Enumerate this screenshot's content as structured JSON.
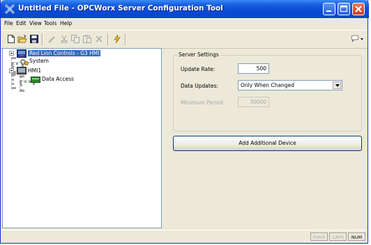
{
  "window": {
    "title": "Untitled File - OPCWorx Server Configuration Tool"
  },
  "menu": {
    "items": [
      "File",
      "Edit",
      "View",
      "Tools",
      "Help"
    ]
  },
  "toolbar": {
    "buttons": [
      "new-icon",
      "open-icon",
      "save-icon",
      "edit-icon",
      "cut-icon",
      "copy-icon",
      "paste-icon",
      "delete-icon",
      "lightning-icon",
      "help-icon"
    ]
  },
  "tree": {
    "root": "Red Lion Controls - G3 HMI",
    "system": "System",
    "hmi": "HMI1",
    "data_access": "Data Access"
  },
  "server_settings": {
    "title": "Server Settings",
    "update_rate_label": "Update Rate:",
    "update_rate_value": "500",
    "data_updates_label": "Data Updates:",
    "data_updates_value": "Only When Changed",
    "minimum_period_label": "Minimum Period:",
    "minimum_period_value": "30000"
  },
  "add_device_button": "Add Additional Device",
  "status": {
    "over": "OVER",
    "caps": "CAPS",
    "num": "NUM"
  },
  "colors": {
    "titlebar": "#0a4bd6",
    "selection": "#316ac5"
  }
}
